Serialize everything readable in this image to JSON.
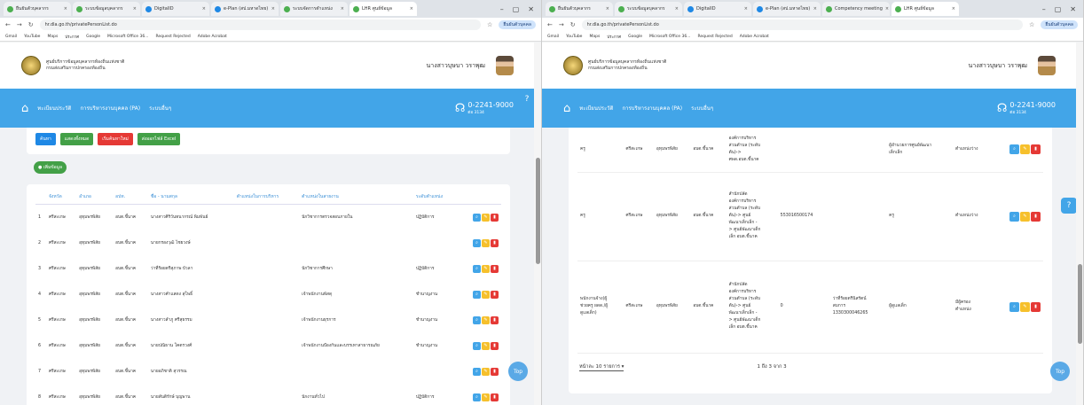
{
  "tabs": [
    {
      "label": "ยืนยันตัวบุคลากร"
    },
    {
      "label": "ระบบข้อมูลบุคลากร"
    },
    {
      "label": "DigitalID"
    },
    {
      "label": "e-Plan (สป.มหาดไทย)"
    },
    {
      "label": "ระบบจัดการตำแหน่ง"
    },
    {
      "label": "Competency meeting"
    },
    {
      "label": "LHR ศูนย์ข้อมูล"
    }
  ],
  "browser": {
    "url_left": "hr.dla.go.th/privatePersonList.do",
    "url_right": "hr.dla.go.th/privatePersonList.do",
    "profile": "ยืนยันตัวบุคคล",
    "bookmarks": [
      "Gmail",
      "YouTube",
      "Maps",
      "ประกาศ",
      "Google",
      "Microsoft Office 36...",
      "Request Rejected",
      "Adobe Acrobat"
    ]
  },
  "site": {
    "org_line1": "ศูนย์บริการข้อมูลบุคลากรท้องถิ่นแห่งชาติ",
    "org_line2": "กรมส่งเสริมการปกครองท้องถิ่น",
    "user_name": "นางสาวบุษบา วราพุฒ",
    "nav": [
      "ทะเบียนประวัติ",
      "การบริหารงานบุคคล (PA)",
      "ระบบอื่นๆ"
    ],
    "phone": "0-2241-9000",
    "phone_ext": "ต่อ 3134"
  },
  "left": {
    "buttons": [
      "ค้นหา",
      "แสดงทั้งหมด",
      "เริ่มค้นหาใหม่",
      "ส่งออกไฟล์ Excel"
    ],
    "add_label": "เพิ่มข้อมูล",
    "columns": [
      "จังหวัด",
      "อำเภอ",
      "อปท.",
      "ชื่อ - นามสกุล",
      "ตำแหน่งในการบริหาร",
      "ตำแหน่งในสายงาน",
      "ระดับตำแหน่ง"
    ],
    "rows": [
      {
        "n": "1",
        "prov": "ศรีสะเกษ",
        "amp": "อุทุมพรพิสัย",
        "org": "อบต.ขี้นาค",
        "name": "นางสาวศิริวันทนากรณ์ พิมพันธ์",
        "adm": "",
        "pos": "นักวิชาการตรวจสอบภายใน",
        "lvl": "ปฏิบัติการ"
      },
      {
        "n": "2",
        "prov": "ศรีสะเกษ",
        "amp": "อุทุมพรพิสัย",
        "org": "อบต.ขี้นาค",
        "name": "นายกรองวุฒิ ไชยวงษ์",
        "adm": "",
        "pos": "",
        "lvl": ""
      },
      {
        "n": "3",
        "prov": "ศรีสะเกษ",
        "amp": "อุทุมพรพิสัย",
        "org": "อบต.ขี้นาค",
        "name": "ว่าที่ร้อยตรีสุภาพ บัวลา",
        "adm": "",
        "pos": "นักวิชาการศึกษา",
        "lvl": "ปฏิบัติการ"
      },
      {
        "n": "4",
        "prov": "ศรีสะเกษ",
        "amp": "อุทุมพรพิสัย",
        "org": "อบต.ขี้นาค",
        "name": "นางสาวคำแสดง สุโพธิ์",
        "adm": "",
        "pos": "เจ้าพนักงานพัสดุ",
        "lvl": "ชำนาญงาน"
      },
      {
        "n": "5",
        "prov": "ศรีสะเกษ",
        "amp": "อุทุมพรพิสัย",
        "org": "อบต.ขี้นาค",
        "name": "นางสาวลำภู ศรีสุธรรม",
        "adm": "",
        "pos": "เจ้าพนักงานธุรการ",
        "lvl": "ชำนาญงาน"
      },
      {
        "n": "6",
        "prov": "ศรีสะเกษ",
        "amp": "อุทุมพรพิสัย",
        "org": "อบต.ขี้นาค",
        "name": "นายปณิธาน โคตรวงศ์",
        "adm": "",
        "pos": "เจ้าพนักงานป้องกันและบรรเทาสาธารณภัย",
        "lvl": "ชำนาญงาน"
      },
      {
        "n": "7",
        "prov": "ศรีสะเกษ",
        "amp": "อุทุมพรพิสัย",
        "org": "อบต.ขี้นาค",
        "name": "นายอภิชาติ สุวรรณ",
        "adm": "",
        "pos": "",
        "lvl": ""
      },
      {
        "n": "8",
        "prov": "ศรีสะเกษ",
        "amp": "อุทุมพรพิสัย",
        "org": "อบต.ขี้นาค",
        "name": "นายสันติรักษ์ บุญพาน",
        "adm": "",
        "pos": "นักงานทั่วไป",
        "lvl": "ปฏิบัติการ"
      }
    ]
  },
  "right": {
    "rows": [
      {
        "c1": "ครู",
        "c2": "ศรีสะเกษ",
        "c3": "อุทุมพรพิสัย",
        "c4": "อบต.ขี้นาค",
        "c5": "องค์การบริหาร\nส่วนตำบล (ระดับ\nต้น)->\nศพด.อบต.ขี้นาค",
        "c6": "",
        "c7": "",
        "c8": "ผู้อำนวยการศูนย์พัฒนา\nเด็กเล็ก",
        "c9": "ตำแหน่งว่าง"
      },
      {
        "c1": "ครู",
        "c2": "ศรีสะเกษ",
        "c3": "อุทุมพรพิสัย",
        "c4": "อบต.ขี้นาค",
        "c5": "สำนักปลัด\nองค์การบริหาร\nส่วนตำบล (ระดับ\nต้น)-> ศูนย์\nพัฒนาเด็กเล็ก -\n> ศูนย์พัฒนาเด็ก\nเล็ก อบต.ขี้นาค",
        "c6": "553016500174",
        "c7": "",
        "c8": "ครู",
        "c9": "ตำแหน่งว่าง"
      },
      {
        "c1": "พนักงานจ้าง(ผู้\nช่วยครู ผดด./ผู้\nดูแลเด็ก)",
        "c2": "ศรีสะเกษ",
        "c3": "อุทุมพรพิสัย",
        "c4": "อบต.ขี้นาค",
        "c5": "สำนักปลัด\nองค์การบริหาร\nส่วนตำบล (ระดับ\nต้น)-> ศูนย์\nพัฒนาเด็กเล็ก -\n> ศูนย์พัฒนาเด็ก\nเล็ก อบต.ขี้นาค",
        "c6": "0",
        "c7": "ว่าที่ร้อยตรีนิสรัตน์\nสมการ\n1330300046265",
        "c8": "ผู้ดูแลเด็ก",
        "c9": "มีผู้ครอง\nตำแหน่ง"
      }
    ],
    "per_page": "หน้าละ 10 รายการ",
    "range": "1 ถึง 3 จาก 3"
  },
  "top_label": "Top",
  "help_label": "?"
}
